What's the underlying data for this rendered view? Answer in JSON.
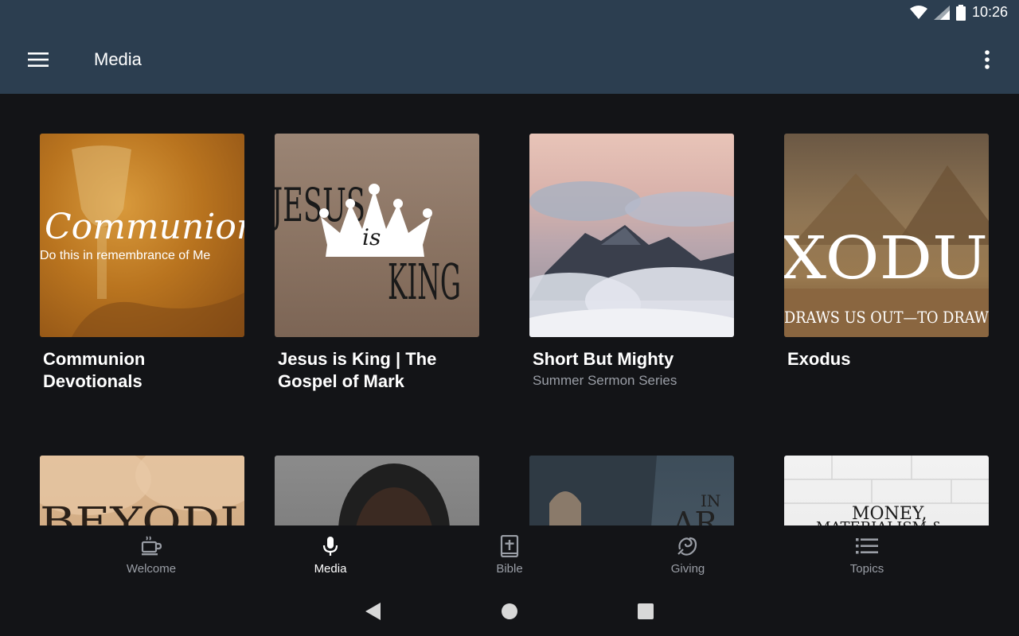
{
  "status_bar": {
    "time": "10:26"
  },
  "app_bar": {
    "title": "Media"
  },
  "icons": {
    "menu": "hamburger-menu-icon",
    "overflow": "more-vertical-icon",
    "wifi": "wifi-icon",
    "signal": "cell-signal-icon",
    "battery": "battery-icon"
  },
  "cards": [
    {
      "title": "Communion Devotionals",
      "subtitle": "",
      "art_text": "Communion",
      "art_sub": "Do this in remembrance of Me"
    },
    {
      "title": "Jesus is King | The Gospel of Mark",
      "subtitle": "",
      "art_text": "JESUS",
      "art_sub": "KING",
      "art_mid": "is"
    },
    {
      "title": "Short But Mighty",
      "subtitle": "Summer Sermon Series"
    },
    {
      "title": "Exodus",
      "subtitle": "",
      "art_text": "XODU",
      "art_sub": "DRAWS US OUT—TO DRAW"
    },
    {
      "title": "",
      "subtitle": "",
      "art_text": "BEYODI"
    },
    {
      "title": "",
      "subtitle": ""
    },
    {
      "title": "",
      "subtitle": "",
      "art_text": "AR",
      "art_sub": "IN"
    },
    {
      "title": "",
      "subtitle": "",
      "art_text": "MONEY,",
      "art_sub": "MATERIALISM &"
    }
  ],
  "bottom_nav": [
    {
      "label": "Welcome",
      "icon": "coffee-cup-icon",
      "active": false
    },
    {
      "label": "Media",
      "icon": "microphone-icon",
      "active": true
    },
    {
      "label": "Bible",
      "icon": "bible-icon",
      "active": false
    },
    {
      "label": "Giving",
      "icon": "giving-icon",
      "active": false
    },
    {
      "label": "Topics",
      "icon": "list-icon",
      "active": false
    }
  ],
  "system_nav": {
    "back": "back-triangle-icon",
    "home": "home-circle-icon",
    "recents": "recents-square-icon"
  },
  "colors": {
    "app_bar": "#2c3e50",
    "background": "#131417",
    "active": "#ffffff",
    "inactive": "#9a9ea6"
  }
}
